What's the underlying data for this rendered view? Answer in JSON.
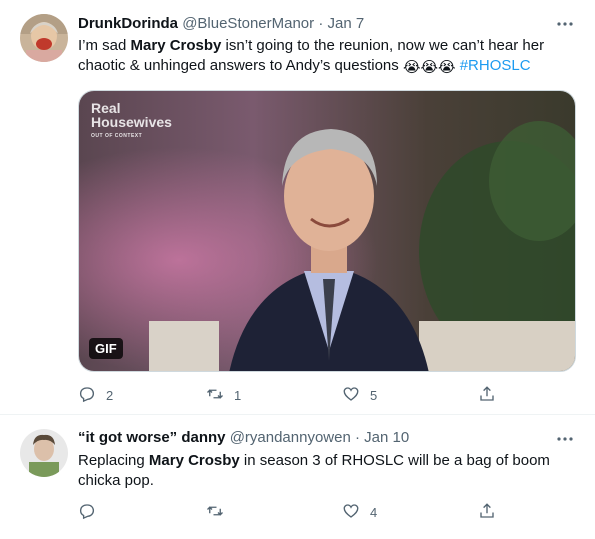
{
  "tweets": [
    {
      "display_name": "DrunkDorinda",
      "handle": "@BlueStonerManor",
      "separator": "·",
      "date": "Jan 7",
      "text_parts": [
        "I’m sad ",
        "Mary Crosby",
        " isn’t going to the reunion, now we can’t hear her chaotic & unhinged answers to Andy’s questions "
      ],
      "emojis": "😭😭😭",
      "hashtag": "#RHOSLC",
      "media": {
        "badge": "GIF",
        "watermark_line1": "Real",
        "watermark_line2": "Housewives",
        "watermark_line3": "OUT OF CONTEXT"
      },
      "actions": {
        "replies": "2",
        "retweets": "1",
        "likes": "5"
      }
    },
    {
      "display_name": "“it got worse” danny",
      "handle": "@ryandannyowen",
      "separator": "·",
      "date": "Jan 10",
      "text_parts": [
        "Replacing ",
        "Mary Crosby",
        " in season 3 of RHOSLC will be a bag of boom chicka pop."
      ],
      "actions": {
        "replies": "",
        "retweets": "",
        "likes": "4"
      }
    }
  ],
  "icons": {
    "more": "more-dots-icon",
    "reply": "reply-bubble-icon",
    "retweet": "retweet-icon",
    "like": "heart-icon",
    "share": "share-icon"
  },
  "colors": {
    "text": "#0f1419",
    "secondary": "#536471",
    "link": "#1d9bf0",
    "border": "#eff3f4"
  }
}
